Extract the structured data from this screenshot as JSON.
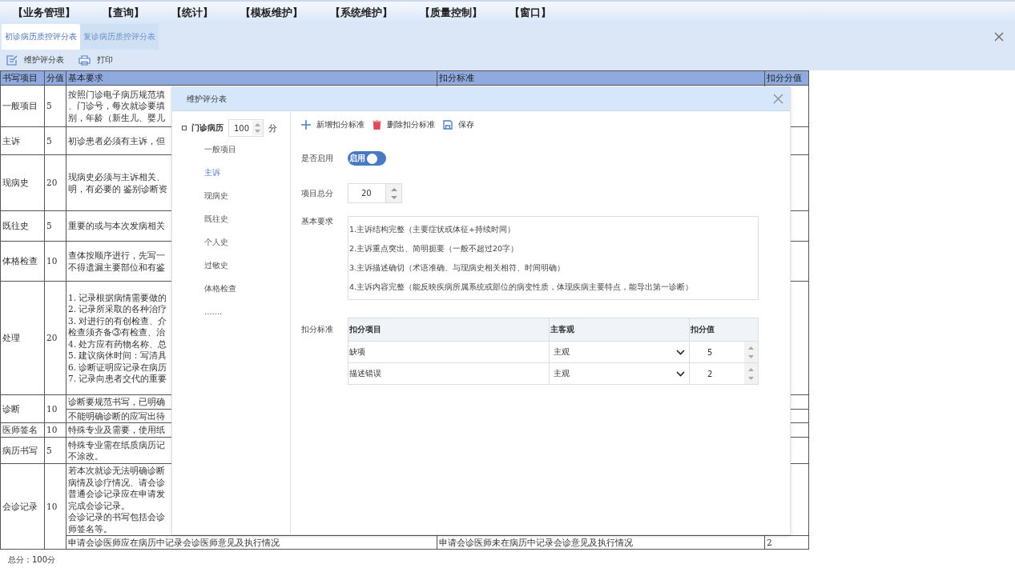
{
  "menu": [
    "【业务管理】",
    "【查询】",
    "【统计】",
    "【模板维护】",
    "【系统维护】",
    "【质量控制】",
    "【窗口】"
  ],
  "tabs": [
    {
      "label": "初诊病历质控评分表",
      "selected": true
    },
    {
      "label": "复诊病历质控评分表",
      "selected": false
    }
  ],
  "toolbar": [
    {
      "label": "维护评分表",
      "kind": "edit"
    },
    {
      "label": "打印",
      "kind": "print"
    }
  ],
  "table": {
    "columns": [
      "书写项目",
      "分值",
      "基本要求",
      "扣分标准",
      "扣分分值"
    ],
    "rows": [
      {
        "item": "一般项目",
        "score": "5",
        "subrows": [
          {
            "requirement": [
              "按照门诊电子病历规范填",
              "、门诊号，每次就诊要填",
              "别，年龄（新生儿、婴儿"
            ]
          }
        ]
      },
      {
        "item": "主诉",
        "score": "5",
        "subrows": [
          {
            "requirement": [
              "初诊患者必须有主诉，但"
            ]
          }
        ]
      },
      {
        "item": "现病史",
        "score": "20",
        "subrows": [
          {
            "requirement": [
              "现病史必须与主诉相关、",
              "明，有必要的 鉴别诊断资"
            ]
          }
        ]
      },
      {
        "item": "既往史",
        "score": "5",
        "subrows": [
          {
            "requirement": [
              "重要的或与本次发病相关"
            ]
          }
        ]
      },
      {
        "item": "体格检查",
        "score": "10",
        "subrows": [
          {
            "requirement": [
              "查体按顺序进行，先写一",
              "不得遗漏主要部位和有鉴"
            ]
          }
        ]
      },
      {
        "item": "处理",
        "score": "20",
        "subrows": [
          {
            "requirement": [
              "1. 记录根据病情需要做的",
              "2. 记录所采取的各种治疗",
              "3. 对进行的有创检查、介",
              "检查须齐备③有检查、治",
              "4. 处方应有药物名称、总",
              "5. 建议病休时间：写清具",
              "6. 诊断证明应记录在病历",
              "7. 记录向患者交代的重要"
            ]
          }
        ]
      },
      {
        "item": "诊断",
        "score": "10",
        "subrows": [
          {
            "requirement": [
              "诊断要规范书写，已明确"
            ]
          },
          {
            "requirement": [
              "不能明确诊断的应写出待"
            ]
          }
        ]
      },
      {
        "item": "医师签名",
        "score": "10",
        "subrows": [
          {
            "requirement": [
              "特殊专业及需要，使用纸"
            ]
          }
        ]
      },
      {
        "item": "病历书写",
        "score": "5",
        "subrows": [
          {
            "requirement": [
              "特殊专业需在纸质病历记",
              "不涂改。"
            ]
          }
        ]
      },
      {
        "item": "会诊记录",
        "score": "10",
        "subrows": [
          {
            "requirement": [
              "若本次就诊无法明确诊断",
              "病情及诊疗情况、请会诊",
              "普通会诊记录应在申请发",
              "完成会诊记录。",
              "会诊记录的书写包括会诊",
              "师签名等。"
            ]
          },
          {
            "requirement": [
              "申请会诊医师应在病历中记录会诊医师意见及执行情况"
            ],
            "criterion": "申请会诊医师未在病历中记录会诊意见及执行情况",
            "value": "2"
          }
        ]
      }
    ]
  },
  "footer": "总分：100分",
  "dialog": {
    "title": "维护评分表",
    "tree": {
      "label": "门诊病历",
      "score": "100",
      "unit": "分",
      "children": [
        {
          "label": "一般项目",
          "selected": false
        },
        {
          "label": "主诉",
          "selected": true
        },
        {
          "label": "现病史",
          "selected": false
        },
        {
          "label": "既往史",
          "selected": false
        },
        {
          "label": "个人史",
          "selected": false
        },
        {
          "label": "过敏史",
          "selected": false
        },
        {
          "label": "体格检查",
          "selected": false
        },
        {
          "label": ".......",
          "selected": false
        }
      ]
    },
    "actions": [
      {
        "label": "新增扣分标准",
        "kind": "add"
      },
      {
        "label": "删除扣分标准",
        "kind": "delete"
      },
      {
        "label": "保存",
        "kind": "save"
      }
    ],
    "enabled": {
      "label": "是否启用",
      "switch_label": "启用",
      "on": true
    },
    "total": {
      "label": "项目总分",
      "value": "20"
    },
    "requirements": {
      "label": "基本要求",
      "lines": [
        "1.主诉结构完整（主要症状或体征+持续时间）",
        "2.主诉重点突出、简明扼要（一般不超过20字）",
        "3.主诉描述确切（术语准确、与现病史相关相符、时间明确）",
        "4.主诉内容完整（能反映疾病所属系统或部位的病变性质，体现疾病主要特点，能导出第一诊断）"
      ]
    },
    "deductions": {
      "label": "扣分标准",
      "columns": [
        "扣分项目",
        "主客观",
        "扣分值"
      ],
      "rows": [
        {
          "item": "缺项",
          "type": "主观",
          "value": "5"
        },
        {
          "item": "描述错误",
          "type": "主观",
          "value": "2"
        }
      ]
    }
  }
}
